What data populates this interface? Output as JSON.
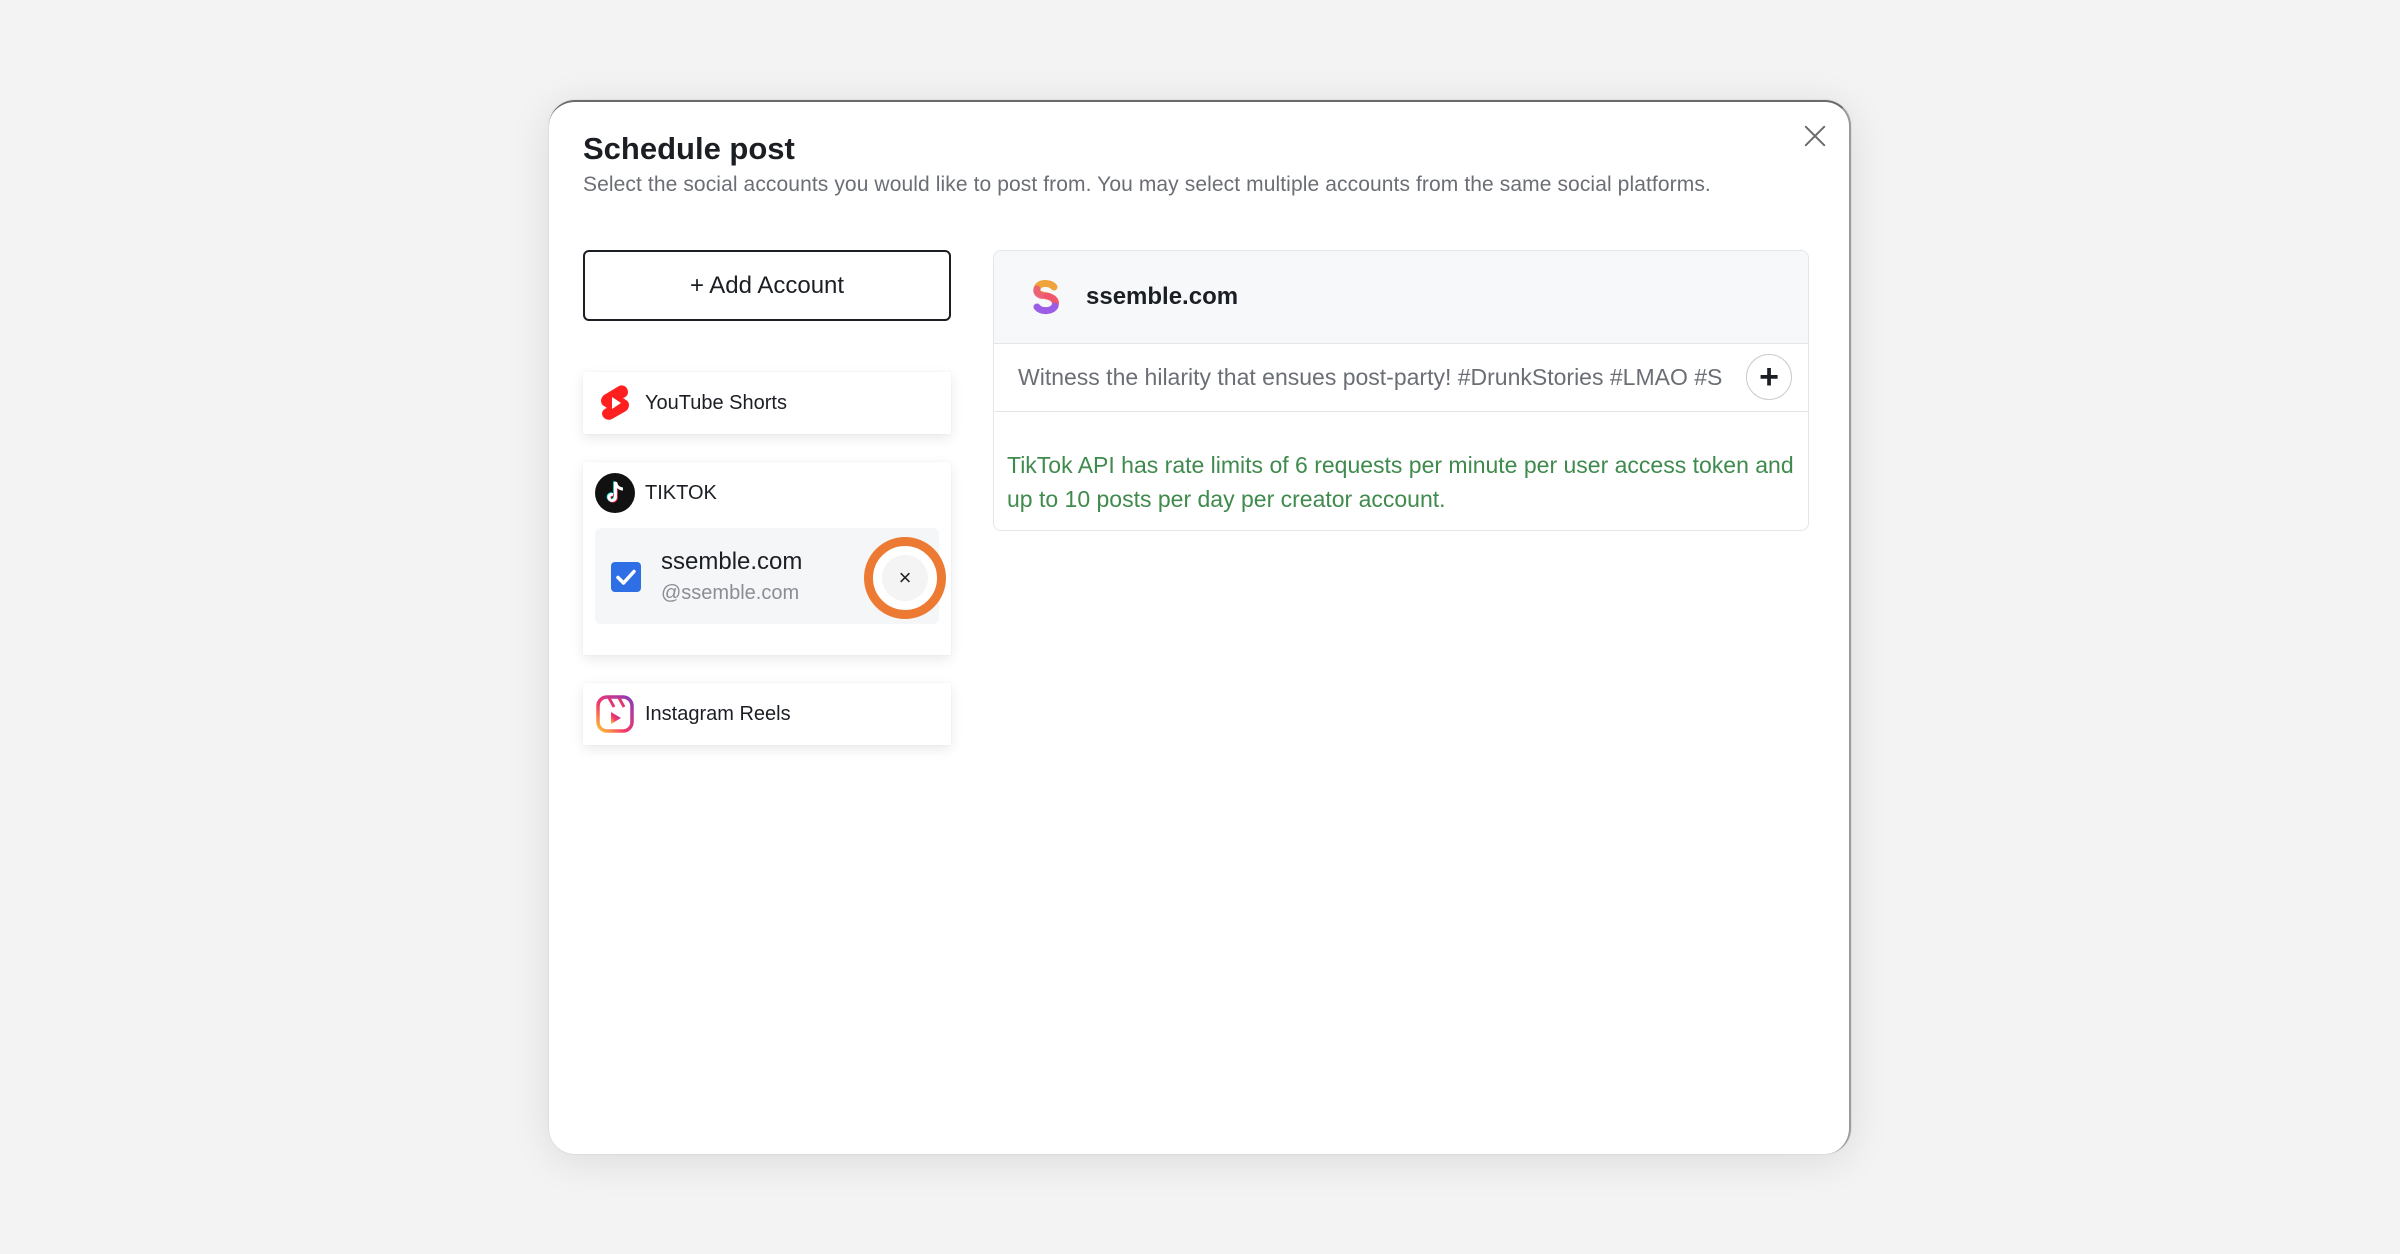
{
  "modal": {
    "title": "Schedule post",
    "subtitle": "Select the social accounts you would like to post from. You may select multiple accounts from the same social platforms.",
    "close_icon": "close-icon"
  },
  "sidebar": {
    "add_account_label": "+ Add Account",
    "platforms": [
      {
        "label": "YouTube Shorts",
        "icon": "youtube-shorts-icon"
      },
      {
        "label": "TIKTOK",
        "icon": "tiktok-icon",
        "accounts": [
          {
            "name": "ssemble.com",
            "handle": "@ssemble.com",
            "checked": true,
            "remove_label": "×"
          }
        ]
      },
      {
        "label": "Instagram Reels",
        "icon": "instagram-reels-icon"
      }
    ]
  },
  "editor": {
    "account_name": "ssemble.com",
    "account_icon": "ssemble-logo-icon",
    "caption": "Witness the hilarity that ensues post-party! #DrunkStories #LMAO #S",
    "plus_label": "+",
    "notice": "TikTok API has rate limits of 6 requests per minute per user access token and up to 10 posts per day per creator account."
  },
  "colors": {
    "accent_blue": "#2f6fe5",
    "highlight_orange": "#ec7a33",
    "notice_green": "#3f8a4d"
  }
}
